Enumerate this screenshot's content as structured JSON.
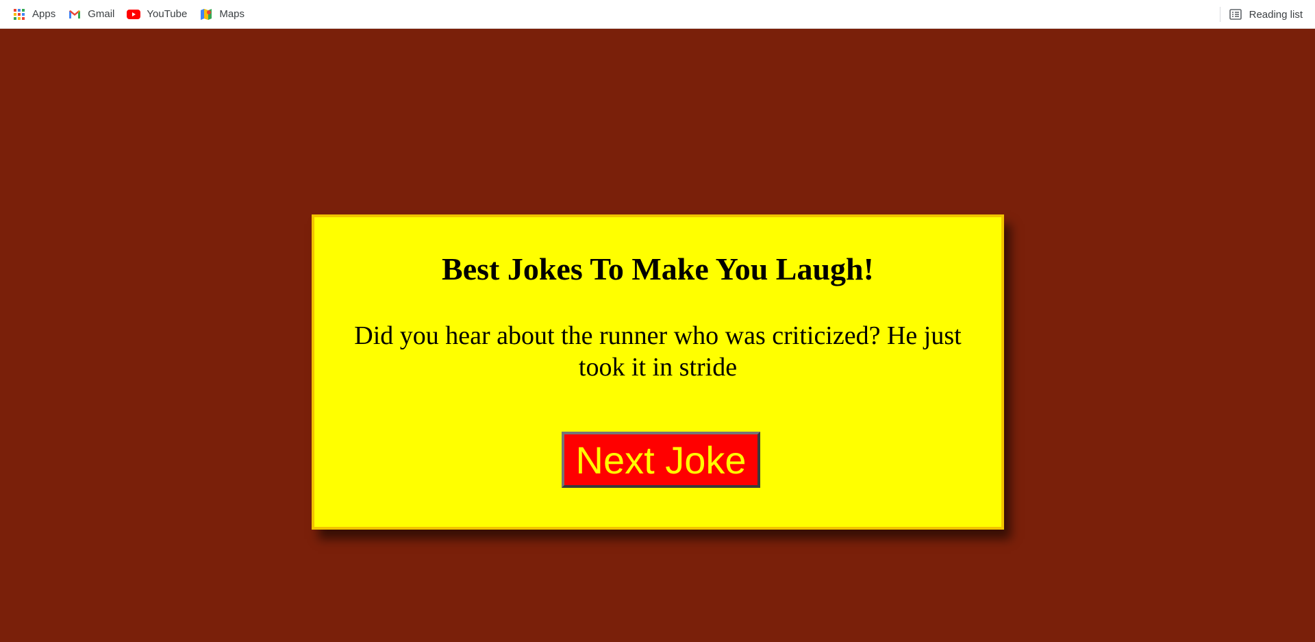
{
  "bookmarks_bar": {
    "items": [
      {
        "label": "Apps",
        "icon": "apps-grid-icon"
      },
      {
        "label": "Gmail",
        "icon": "gmail-icon"
      },
      {
        "label": "YouTube",
        "icon": "youtube-icon"
      },
      {
        "label": "Maps",
        "icon": "maps-icon"
      }
    ],
    "reading_list": {
      "label": "Reading list",
      "icon": "reading-list-icon"
    }
  },
  "page": {
    "background_color": "#7a200a",
    "card_color": "#ffff00",
    "title": "Best Jokes To Make You Laugh!",
    "joke": "Did you hear about the runner who was criticized? He just took it in stride",
    "button_label": "Next Joke",
    "button_color": "#ff0000",
    "button_text_color": "#ffff00"
  }
}
